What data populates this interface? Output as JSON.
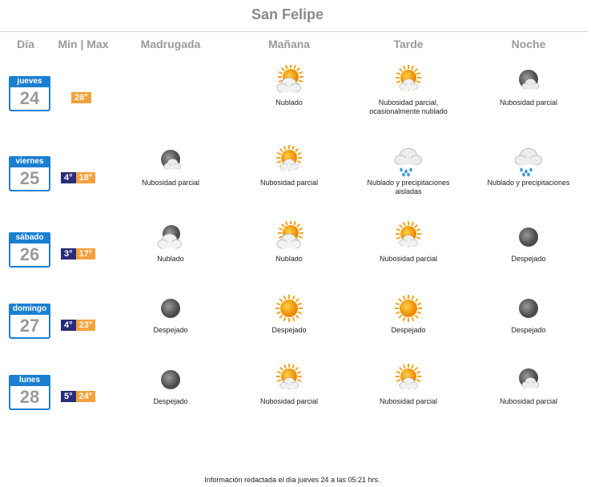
{
  "title": "San Felipe",
  "headers": [
    "Día",
    "Min | Max",
    "Madrugada",
    "Mañana",
    "Tarde",
    "Noche"
  ],
  "days": [
    {
      "weekday": "jueves",
      "day": "24",
      "min": "",
      "max": "26°",
      "periods": [
        {
          "icon": "",
          "desc": ""
        },
        {
          "icon": "cloudy-sun-icon",
          "desc": "Nublado"
        },
        {
          "icon": "partly-cloudy-sun-icon",
          "desc": "Nubosidad parcial,\nocasionalmente nublado"
        },
        {
          "icon": "partly-cloudy-moon-icon",
          "desc": "Nubosidad parcial"
        }
      ]
    },
    {
      "weekday": "viernes",
      "day": "25",
      "min": "4°",
      "max": "18°",
      "periods": [
        {
          "icon": "partly-cloudy-moon-icon",
          "desc": "Nubosidad parcial"
        },
        {
          "icon": "partly-cloudy-sun-icon",
          "desc": "Nubosidad parcial"
        },
        {
          "icon": "rain-cloud-icon",
          "desc": "Nublado y precipitaciones\naisladas"
        },
        {
          "icon": "rain-cloud-icon",
          "desc": "Nublado y precipitaciones"
        }
      ]
    },
    {
      "weekday": "sábado",
      "day": "26",
      "min": "3°",
      "max": "17°",
      "periods": [
        {
          "icon": "cloudy-moon-icon",
          "desc": "Nublado"
        },
        {
          "icon": "cloudy-sun-icon",
          "desc": "Nublado"
        },
        {
          "icon": "partly-cloudy-sun-icon",
          "desc": "Nubosidad parcial"
        },
        {
          "icon": "clear-moon-icon",
          "desc": "Despejado"
        }
      ]
    },
    {
      "weekday": "domingo",
      "day": "27",
      "min": "4°",
      "max": "23°",
      "periods": [
        {
          "icon": "clear-moon-icon",
          "desc": "Despejado"
        },
        {
          "icon": "sun-icon",
          "desc": "Despejado"
        },
        {
          "icon": "sun-icon",
          "desc": "Despejado"
        },
        {
          "icon": "clear-moon-icon",
          "desc": "Despejado"
        }
      ]
    },
    {
      "weekday": "lunes",
      "day": "28",
      "min": "5°",
      "max": "24°",
      "periods": [
        {
          "icon": "clear-moon-icon",
          "desc": "Despejado"
        },
        {
          "icon": "partly-cloudy-sun-icon",
          "desc": "Nubosidad parcial"
        },
        {
          "icon": "partly-cloudy-sun-icon",
          "desc": "Nubosidad parcial"
        },
        {
          "icon": "partly-cloudy-moon-icon",
          "desc": "Nubosidad parcial"
        }
      ]
    }
  ],
  "footer": "Información redactada el día jueves 24 a las 05:21 hrs.",
  "colors": {
    "calendar_blue": "#1a7fd1",
    "min_bg": "#2b2b7a",
    "max_bg": "#f4a23c",
    "sun": "#f7a21b",
    "moon": "#6e6e6e"
  }
}
